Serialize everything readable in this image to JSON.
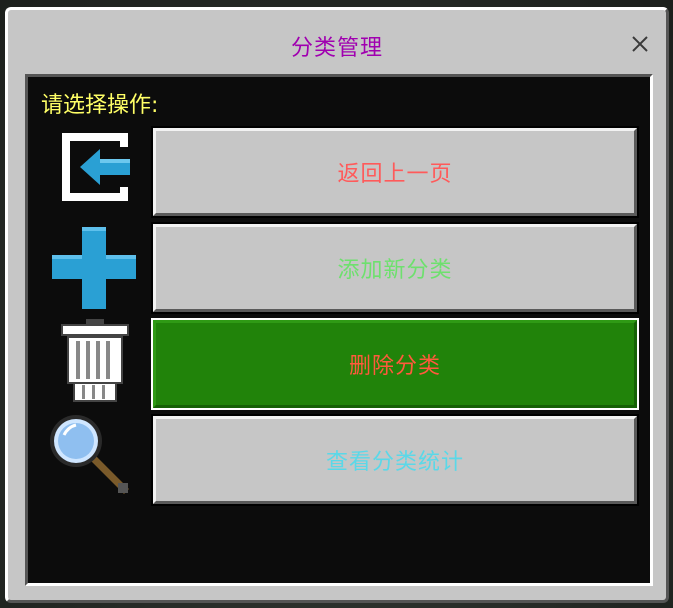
{
  "dialog": {
    "title": "分类管理",
    "close_symbol": "✕",
    "prompt": "请选择操作:"
  },
  "menu": [
    {
      "label": "返回上一页",
      "icon": "back-arrow-icon",
      "color": "#ff5a5a",
      "selected": false
    },
    {
      "label": "添加新分类",
      "icon": "plus-icon",
      "color": "#6ee06e",
      "selected": false
    },
    {
      "label": "删除分类",
      "icon": "trash-can-icon",
      "color": "#ff5a3c",
      "selected": true
    },
    {
      "label": "查看分类统计",
      "icon": "magnifier-icon",
      "color": "#5ad8e8",
      "selected": false
    }
  ],
  "colors": {
    "title": "#a000b0",
    "prompt": "#ffff66",
    "selected_button": "#21830a",
    "button": "#c6c6c6"
  }
}
